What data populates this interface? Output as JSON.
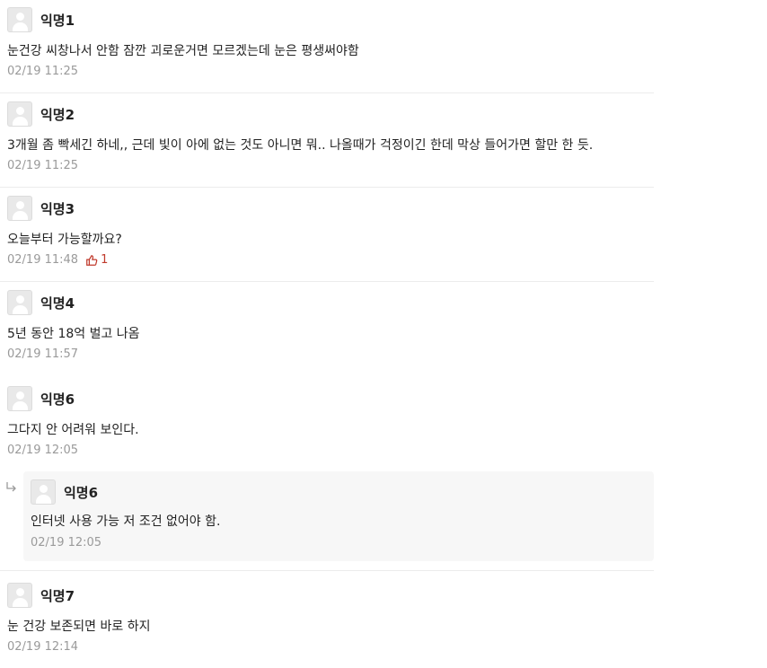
{
  "comments": [
    {
      "author": "익명1",
      "text": "눈건강 씨창나서 안함 잠깐 괴로운거면 모르겠는데 눈은 평생써야함",
      "time": "02/19 11:25"
    },
    {
      "author": "익명2",
      "text": "3개월 좀 빡세긴 하네,, 근데 빛이 아에 없는 것도 아니면 뭐.. 나올때가 걱정이긴 한데 막상 들어가면 할만 한 듯.",
      "time": "02/19 11:25"
    },
    {
      "author": "익명3",
      "text": "오늘부터 가능할까요?",
      "time": "02/19 11:48",
      "likes": "1"
    },
    {
      "author": "익명4",
      "text": "5년 동안 18억 벌고 나옴",
      "time": "02/19 11:57"
    },
    {
      "author": "익명6",
      "text": "그다지 안 어려워 보인다.",
      "time": "02/19 12:05"
    },
    {
      "author": "익명7",
      "text": "눈 건강 보존되면 바로 하지",
      "time": "02/19 12:14"
    }
  ],
  "reply": {
    "author": "익명6",
    "text": "인터넷 사용 가능 저 조건 없어야 함.",
    "time": "02/19 12:05"
  },
  "icons": {
    "avatar": "default-avatar-icon",
    "like": "thumbs-up-icon",
    "reply": "reply-arrow-icon"
  },
  "colors": {
    "like": "#c0392b",
    "meta": "#9a9a9a",
    "reply_bg": "#f7f7f7"
  }
}
